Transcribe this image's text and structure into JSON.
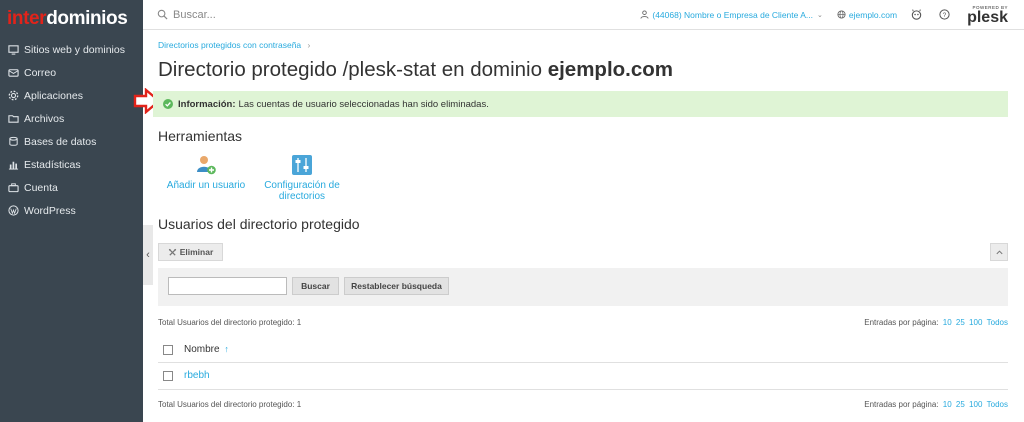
{
  "brand": {
    "part1": "inter",
    "part2": "dominios"
  },
  "sidebar": {
    "items": [
      {
        "label": "Sitios web y dominios",
        "icon": "monitor-icon"
      },
      {
        "label": "Correo",
        "icon": "mail-icon"
      },
      {
        "label": "Aplicaciones",
        "icon": "gear-icon"
      },
      {
        "label": "Archivos",
        "icon": "folder-icon"
      },
      {
        "label": "Bases de datos",
        "icon": "database-icon"
      },
      {
        "label": "Estadísticas",
        "icon": "bar-chart-icon"
      },
      {
        "label": "Cuenta",
        "icon": "briefcase-icon"
      },
      {
        "label": "WordPress",
        "icon": "wordpress-icon"
      }
    ]
  },
  "topbar": {
    "search_placeholder": "Buscar...",
    "account": "(44068) Nombre o Empresa de Cliente A...",
    "domain": "ejemplo.com",
    "powered_by": "POWERED BY",
    "plesk": "plesk"
  },
  "breadcrumb": {
    "label": "Directorios protegidos con contraseña",
    "sep": "›"
  },
  "page": {
    "title_prefix": "Directorio protegido /plesk-stat en dominio",
    "title_domain": "ejemplo.com"
  },
  "info": {
    "label": "Información:",
    "message": "Las cuentas de usuario seleccionadas han sido eliminadas."
  },
  "tools": {
    "heading": "Herramientas",
    "add_user": "Añadir un usuario",
    "config_line1": "Configuración de",
    "config_line2": "directorios"
  },
  "users": {
    "heading": "Usuarios del directorio protegido",
    "delete_label": "Eliminar",
    "search_button": "Buscar",
    "reset_button": "Restablecer búsqueda",
    "total": "Total Usuarios del directorio protegido: 1",
    "per_page_label": "Entradas por página:",
    "per_page_options": [
      "10",
      "25",
      "100",
      "Todos"
    ],
    "column_name": "Nombre",
    "sort_arrow": "↑",
    "rows": [
      {
        "name": "rbebh"
      }
    ]
  },
  "colors": {
    "sidebar_bg": "#3a4650",
    "link": "#28aade",
    "info_bg": "#dff4d5",
    "success": "#5cb85c",
    "annotation_arrow": "#e2231a"
  }
}
